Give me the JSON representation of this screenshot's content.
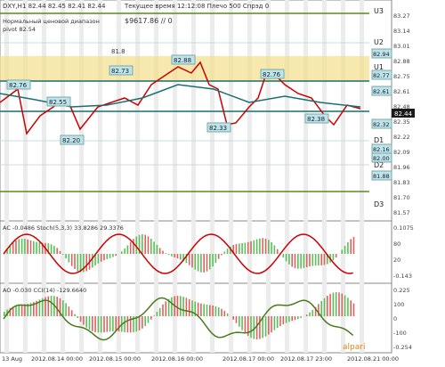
{
  "header": {
    "symbol_line": "DXY,H1  82.44 82.45 82.41 82.44",
    "time_line": "Текущее время 12:12:08 Плечо 500 Спрэд 0",
    "subtitle_line1": "Нормальный ценовой диапазон",
    "subtitle_line2": "pivot 82.54",
    "account_line": "$9617.86   // 0"
  },
  "price_axis": {
    "ticks": [
      "83.27",
      "83.14",
      "83.01",
      "82.88",
      "82.75",
      "82.61",
      "82.48",
      "82.35",
      "82.22",
      "82.09",
      "81.96",
      "81.83",
      "81.70",
      "81.57"
    ],
    "current_price": "82.44"
  },
  "levels": {
    "right": [
      "U3",
      "U2",
      "U1",
      "D1",
      "D2",
      "D3"
    ],
    "value_tags": [
      "82.94",
      "82.77",
      "82.61",
      "82.32",
      "82.16",
      "81.88",
      "82.00"
    ],
    "left_tags": [
      "82.76",
      "82.55",
      "82.20",
      "82.73",
      "82.88",
      "82.33",
      "82.76",
      "82.38"
    ],
    "top_label": "81.8",
    "osc_tag": "OC"
  },
  "ac_panel": {
    "title": "AC -0.0486  Stoch(5,3,3) 33.8286 29.3376",
    "right_ticks": [
      "0.1075",
      "80",
      "20",
      "-0.143"
    ]
  },
  "ao_panel": {
    "title": "AO -0.030  CCI(14) -129.6640",
    "right_ticks": [
      "0.225",
      "100",
      "0",
      "-100",
      "-0.254"
    ],
    "logo": "alpari"
  },
  "time_axis": [
    "13 Aug",
    "2012.08.14 00:00",
    "2012.08.15 00:00",
    "2012.08.16 00:00",
    "2012.08.17 00:00",
    "2012.08.17 23:00",
    "2012.08.21 00:00"
  ],
  "colors": {
    "price_line": "#1a6f6f",
    "candle": "#cc0000",
    "ma_green": "#5b8a1e",
    "zone": "#f3e08a",
    "stoch": "#cc0000",
    "bars_red": "#e06060",
    "bars_green": "#5bbf5b"
  },
  "chart_data": {
    "type": "line",
    "title": "DXY,H1",
    "x": [
      "2012.08.14 00:00",
      "2012.08.15 00:00",
      "2012.08.16 00:00",
      "2012.08.17 00:00",
      "2012.08.17 23:00",
      "2012.08.21 00:00"
    ],
    "series": [
      {
        "name": "DXY",
        "values": [
          82.27,
          82.55,
          82.73,
          82.88,
          82.33,
          82.44
        ]
      }
    ],
    "ylim": [
      81.5,
      83.3
    ]
  }
}
